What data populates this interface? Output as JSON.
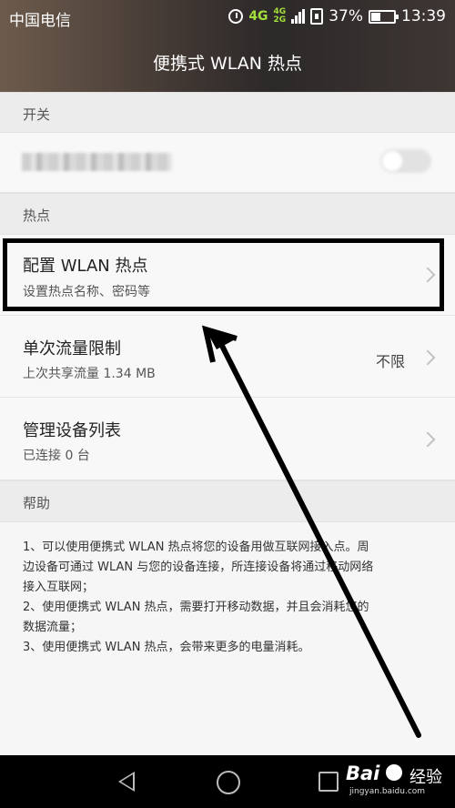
{
  "status_bar": {
    "carrier": "中国电信",
    "network": "4G",
    "network_secondary": [
      "4G",
      "2G"
    ],
    "battery": "37%",
    "time": "13:39",
    "icons": [
      "alarm-icon",
      "signal-icon",
      "sim-icon",
      "battery-icon"
    ]
  },
  "header": {
    "title": "便携式 WLAN 热点"
  },
  "sections": {
    "switch": {
      "label": "开关"
    },
    "hotspot": {
      "label": "热点"
    },
    "help": {
      "label": "帮助"
    }
  },
  "rows": {
    "configure": {
      "title": "配置 WLAN 热点",
      "subtitle": "设置热点名称、密码等"
    },
    "data_limit": {
      "title": "单次流量限制",
      "subtitle": "上次共享流量 1.34 MB",
      "value": "不限"
    },
    "devices": {
      "title": "管理设备列表",
      "subtitle": "已连接 0 台"
    }
  },
  "help_text": {
    "lines": [
      "1、可以使用便携式 WLAN 热点将您的设备用做互联网接入点。周",
      "边设备可通过 WLAN 与您的设备连接，所连接设备将通过移动网络",
      "接入互联网；",
      "2、使用便携式 WLAN 热点，需要打开移动数据，并且会消耗您的",
      "数据流量；",
      "3、使用便携式 WLAN 热点，会带来更多的电量消耗。"
    ]
  },
  "watermark": {
    "brand": "Bai",
    "product": "经验",
    "url": "jingyan.baidu.com"
  },
  "colors": {
    "title_bar": "#3b3330",
    "background": "#f6f6f6",
    "section": "#ececec",
    "network_accent": "#a4e03a"
  }
}
